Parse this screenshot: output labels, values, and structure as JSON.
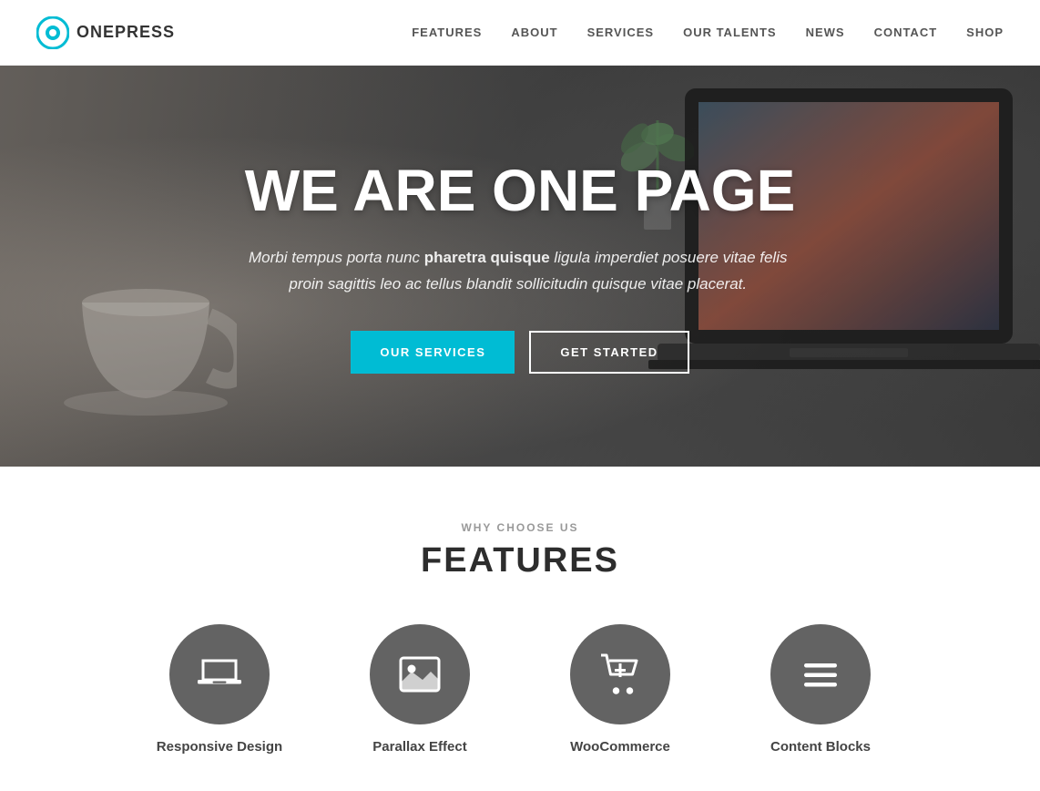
{
  "header": {
    "logo_text": "ONEPRESS",
    "nav_items": [
      {
        "label": "FEATURES",
        "href": "#features"
      },
      {
        "label": "ABOUT",
        "href": "#about"
      },
      {
        "label": "SERVICES",
        "href": "#services"
      },
      {
        "label": "OUR TALENTS",
        "href": "#talents"
      },
      {
        "label": "NEWS",
        "href": "#news"
      },
      {
        "label": "CONTACT",
        "href": "#contact"
      },
      {
        "label": "SHOP",
        "href": "#shop"
      }
    ]
  },
  "hero": {
    "title": "WE ARE ONE PAGE",
    "subtitle_start": "Morbi tempus porta nunc ",
    "subtitle_bold": "pharetra quisque",
    "subtitle_end": " ligula imperdiet posuere vitae felis proin sagittis leo ac tellus blandit sollicitudin quisque vitae placerat.",
    "btn_primary": "OUR SERVICES",
    "btn_secondary": "GET STARTED"
  },
  "features": {
    "subtitle": "WHY CHOOSE US",
    "title": "FEATURES",
    "items": [
      {
        "label": "Responsive Design",
        "icon": "laptop"
      },
      {
        "label": "Parallax Effect",
        "icon": "image"
      },
      {
        "label": "WooCommerce",
        "icon": "cart"
      },
      {
        "label": "Content Blocks",
        "icon": "menu"
      }
    ]
  }
}
